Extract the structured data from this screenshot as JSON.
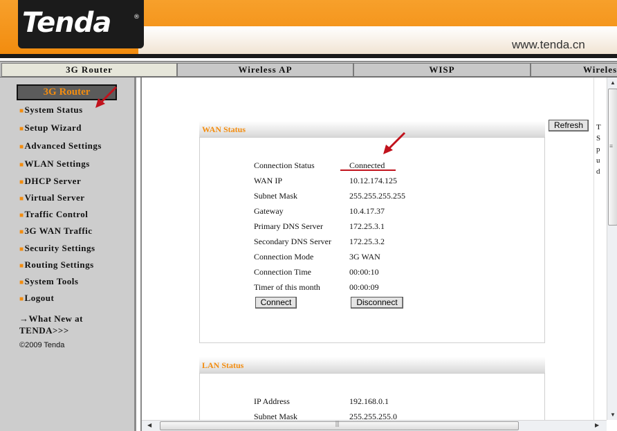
{
  "header": {
    "logo_text": "Tenda",
    "logo_reg": "®",
    "site_url": "www.tenda.cn"
  },
  "tabs": [
    {
      "label": "3G Router",
      "active": true
    },
    {
      "label": "Wireless AP",
      "active": false
    },
    {
      "label": "WISP",
      "active": false
    },
    {
      "label": "Wireless",
      "active": false
    }
  ],
  "sidebar": {
    "title": "3G Router",
    "bullet": "■",
    "items": [
      {
        "label": "System Status"
      },
      {
        "label": "Setup Wizard"
      },
      {
        "label": "Advanced Settings"
      },
      {
        "label": "WLAN Settings"
      },
      {
        "label": "DHCP Server"
      },
      {
        "label": "Virtual Server"
      },
      {
        "label": "Traffic Control"
      },
      {
        "label": "3G WAN Traffic"
      },
      {
        "label": "Security Settings"
      },
      {
        "label": "Routing Settings"
      },
      {
        "label": "System Tools"
      },
      {
        "label": "Logout"
      }
    ],
    "whats_new_line1": "→What New at",
    "whats_new_line2": "TENDA>>>",
    "copyright": "©2009 Tenda"
  },
  "toolbar": {
    "refresh_label": "Refresh"
  },
  "wan": {
    "title": "WAN Status",
    "rows": [
      {
        "label": "Connection Status",
        "value": "Connected"
      },
      {
        "label": "WAN IP",
        "value": "10.12.174.125"
      },
      {
        "label": "Subnet Mask",
        "value": "255.255.255.255"
      },
      {
        "label": "Gateway",
        "value": "10.4.17.37"
      },
      {
        "label": "Primary DNS Server",
        "value": "172.25.3.1"
      },
      {
        "label": "Secondary DNS Server",
        "value": "172.25.3.2"
      },
      {
        "label": "Connection Mode",
        "value": "3G WAN"
      },
      {
        "label": "Connection Time",
        "value": "00:00:10"
      },
      {
        "label": "Timer of this month",
        "value": "00:00:09"
      }
    ],
    "connect_label": "Connect",
    "disconnect_label": "Disconnect"
  },
  "lan": {
    "title": "LAN Status",
    "rows": [
      {
        "label": "IP Address",
        "value": "192.168.0.1"
      },
      {
        "label": "Subnet Mask",
        "value": "255.255.255.0"
      }
    ]
  },
  "right_panel": {
    "chars": [
      "T",
      "S",
      "p",
      "u",
      "d"
    ]
  },
  "colors": {
    "accent": "#f28c0f",
    "annotation_red": "#c1121c"
  }
}
